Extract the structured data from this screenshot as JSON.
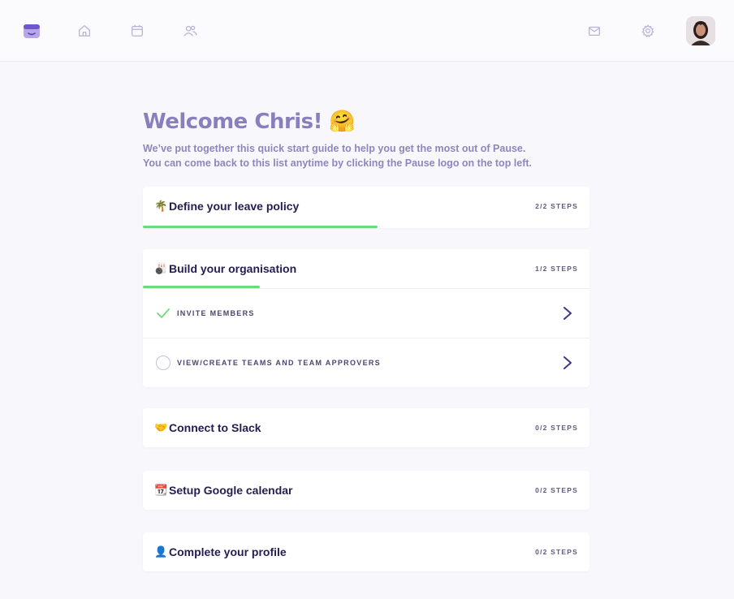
{
  "nav": {
    "logo": "pause-logo-icon",
    "items": [
      "home-icon",
      "calendar-icon",
      "people-icon"
    ],
    "right": [
      "mail-icon",
      "gear-icon"
    ],
    "avatar": "avatar"
  },
  "welcome": {
    "title": "Welcome Chris!",
    "emoji": "🤗",
    "line1": "We’ve put together this quick start guide to help you get the most out of Pause.",
    "line2": "You can come back to this list anytime by clicking the Pause logo on the top left."
  },
  "sections": [
    {
      "emoji": "🌴",
      "title": "Define your leave policy",
      "steps": "2/2 STEPS",
      "progress": 1.0
    },
    {
      "emoji": "🎳",
      "title": "Build your organisation",
      "steps": "1/2 STEPS",
      "progress": 0.5,
      "items": [
        {
          "label": "INVITE MEMBERS",
          "done": true
        },
        {
          "label": "VIEW/CREATE TEAMS AND TEAM APPROVERS",
          "done": false
        }
      ]
    },
    {
      "emoji": "🤝",
      "title": "Connect to Slack",
      "steps": "0/2 STEPS",
      "progress": 0
    },
    {
      "emoji": "📆",
      "title": "Setup Google calendar",
      "steps": "0/2 STEPS",
      "progress": 0
    },
    {
      "emoji": "👤",
      "title": "Complete your profile",
      "steps": "0/2 STEPS",
      "progress": 0
    }
  ],
  "colors": {
    "accent": "#8a7fbe",
    "progress": "#6fd97e",
    "title": "#231d52"
  }
}
